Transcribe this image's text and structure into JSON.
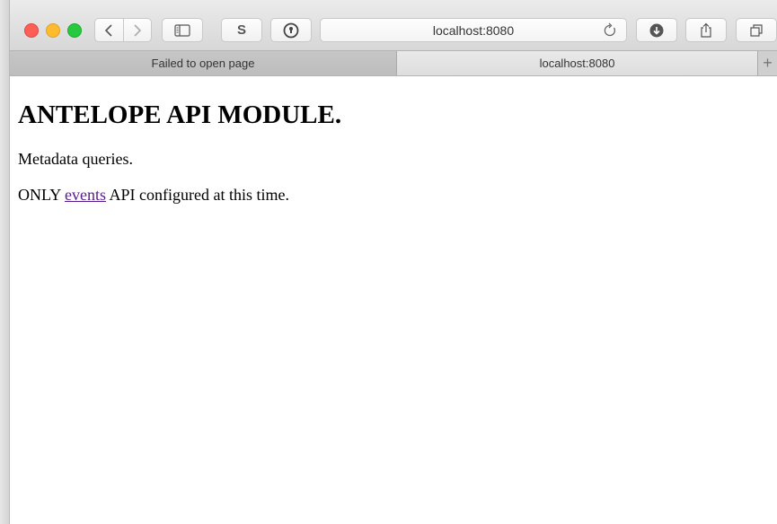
{
  "browser": {
    "address": "localhost:8080",
    "nav_back_icon": "chevron-left-icon",
    "nav_forward_icon": "chevron-right-icon",
    "sidebar_icon": "sidebar-icon",
    "extension_s_label": "S",
    "download_icon": "download-icon",
    "share_icon": "share-icon",
    "tabs_icon": "tabs-overview-icon"
  },
  "tabs": [
    {
      "label": "Failed to open page",
      "active": false
    },
    {
      "label": "localhost:8080",
      "active": true
    }
  ],
  "new_tab_label": "+",
  "page": {
    "heading": "ANTELOPE API MODULE.",
    "line1": "Metadata queries.",
    "line2_before": "ONLY ",
    "line2_link": "events",
    "line2_after": " API configured at this time."
  },
  "colors": {
    "link": "#551a8b",
    "close": "#fd5f57",
    "minimize": "#febb2e",
    "zoom": "#28c840"
  }
}
